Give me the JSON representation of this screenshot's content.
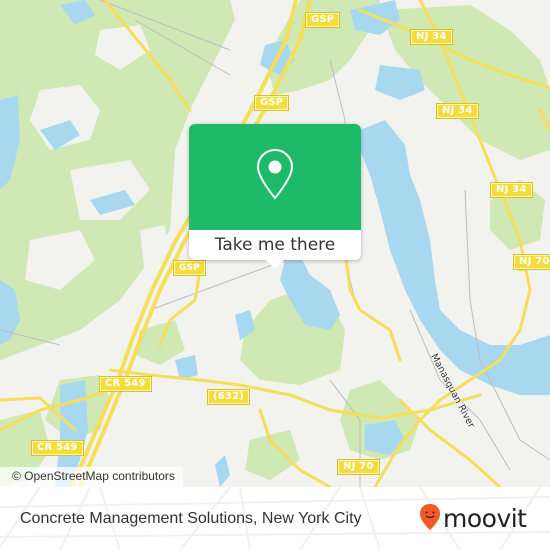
{
  "map": {
    "colors": {
      "land": "#f2f2ef",
      "forest": "#cfe8b4",
      "water": "#a8d8f0",
      "road_major": "#f5de5a",
      "road_minor": "#bdbdbd"
    },
    "road_shields": [
      {
        "id": "gsp-top",
        "label": "GSP"
      },
      {
        "id": "gsp-mid",
        "label": "GSP"
      },
      {
        "id": "gsp-low",
        "label": "GSP"
      },
      {
        "id": "nj34-a",
        "label": "NJ 34"
      },
      {
        "id": "nj34-b",
        "label": "NJ 34"
      },
      {
        "id": "nj34-c",
        "label": "NJ 34"
      },
      {
        "id": "nj70-a",
        "label": "NJ 70"
      },
      {
        "id": "nj70-b",
        "label": "NJ 70"
      },
      {
        "id": "cr549-a",
        "label": "CR 549"
      },
      {
        "id": "cr549-b",
        "label": "CR 549"
      },
      {
        "id": "r632",
        "label": "(632)"
      }
    ],
    "water_labels": [
      {
        "label": "Manasquan River"
      }
    ],
    "attribution": "© OpenStreetMap contributors"
  },
  "popup": {
    "icon": "location-pin-icon",
    "button_label": "Take me there",
    "accent_color": "#1fba68"
  },
  "footer": {
    "place_title": "Concrete Management Solutions, New York City",
    "brand": {
      "name": "moovit",
      "icon": "moovit-pin-smiley-icon",
      "color": "#f05a28"
    }
  }
}
